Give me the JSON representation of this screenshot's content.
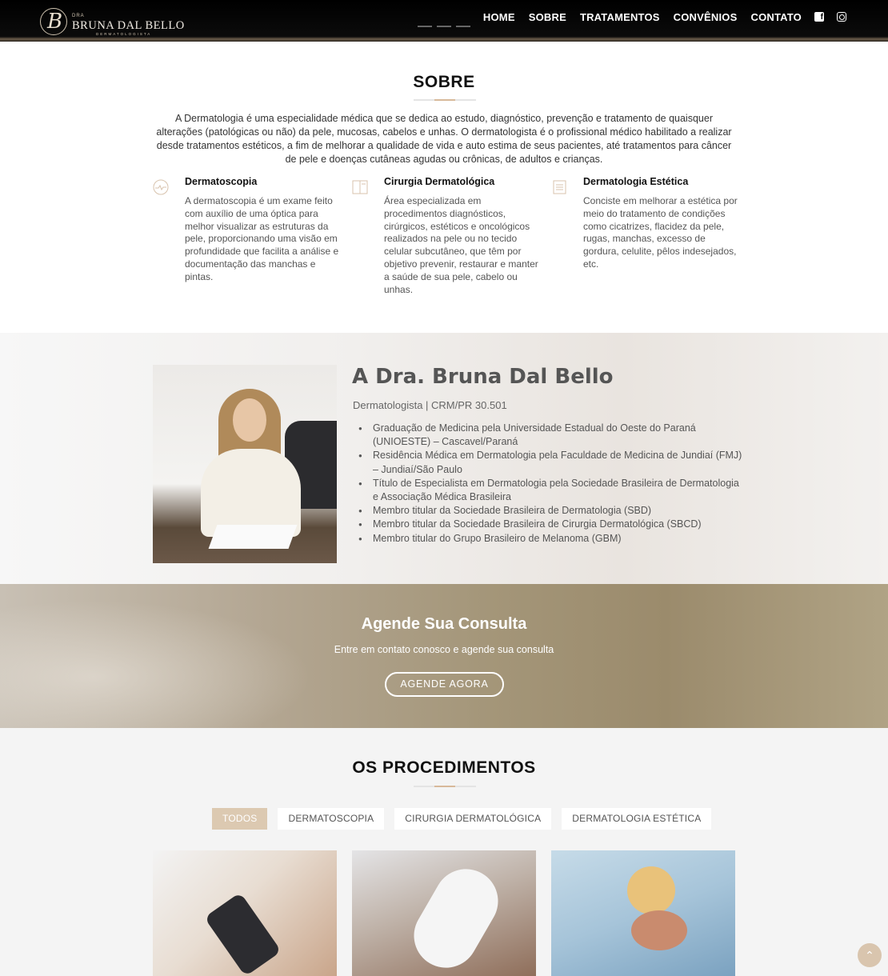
{
  "brand": {
    "prefix": "DRA",
    "name": "BRUNA DAL BELLO",
    "subtitle": "DERMATOLOGISTA",
    "monogram": "B"
  },
  "nav": {
    "items": [
      "HOME",
      "SOBRE",
      "TRATAMENTOS",
      "CONVÊNIOS",
      "CONTATO"
    ],
    "social_icons": [
      "facebook-icon",
      "instagram-icon"
    ]
  },
  "sobre": {
    "title": "SOBRE",
    "text": "A Dermatologia é uma especialidade médica que se dedica ao estudo, diagnóstico, prevenção e tratamento de quaisquer alterações (patológicas ou não) da pele, mucosas, cabelos e unhas. O dermatologista é o profissional médico habilitado a realizar desde tratamentos estéticos, a fim de melhorar a qualidade de vida e auto estima de seus pacientes, até tratamentos para câncer de pele e doenças cutâneas agudas ou crônicas, de adultos e crianças.",
    "features": [
      {
        "icon": "pulse-icon",
        "title": "Dermatoscopia",
        "text": "A dermatoscopia é um exame feito com auxílio de uma óptica para melhor visualizar as estruturas da pele, proporcionando uma visão em profundidade que facilita a análise e documentação das manchas e pintas."
      },
      {
        "icon": "book-icon",
        "title": "Cirurgia Dermatológica",
        "text": "Área especializada em procedimentos diagnósticos, cirúrgicos, estéticos e oncológicos realizados na pele ou no tecido celular subcutâneo, que têm por objetivo prevenir, restaurar e manter a saúde de sua pele, cabelo ou unhas."
      },
      {
        "icon": "document-icon",
        "title": "Dermatologia Estética",
        "text": "Conciste em melhorar a estética por meio do tratamento de condições como cicatrizes, flacidez da pele, rugas, manchas, excesso de gordura, celulite, pêlos indesejados, etc."
      }
    ]
  },
  "doctor": {
    "name": "A Dra. Bruna Dal Bello",
    "role": "Dermatologista | CRM/PR 30.501",
    "credentials": [
      "Graduação de Medicina pela Universidade Estadual do Oeste do Paraná (UNIOESTE) – Cascavel/Paraná",
      "Residência Médica em Dermatologia pela Faculdade de Medicina de Jundiaí (FMJ) – Jundiaí/São Paulo",
      "Título de Especialista em Dermatologia pela Sociedade Brasileira de Dermatologia e Associação Médica Brasileira",
      "Membro titular da Sociedade Brasileira de Dermatologia (SBD)",
      "Membro titular da Sociedade Brasileira de Cirurgia Dermatológica (SBCD)",
      "Membro titular do Grupo Brasileiro de Melanoma (GBM)"
    ]
  },
  "cta": {
    "title": "Agende Sua Consulta",
    "subtitle": "Entre em contato conosco e agende sua consulta",
    "button": "AGENDE AGORA"
  },
  "procedimentos": {
    "title": "OS PROCEDIMENTOS",
    "filters": [
      "TODOS",
      "DERMATOSCOPIA",
      "CIRURGIA DERMATOLÓGICA",
      "DERMATOLOGIA ESTÉTICA"
    ],
    "active_filter": "TODOS"
  },
  "colors": {
    "accent": "#dcc9b1",
    "nav_bg": "#000000",
    "heading": "#111111"
  },
  "scroll_top_icon": "chevron-up-icon"
}
